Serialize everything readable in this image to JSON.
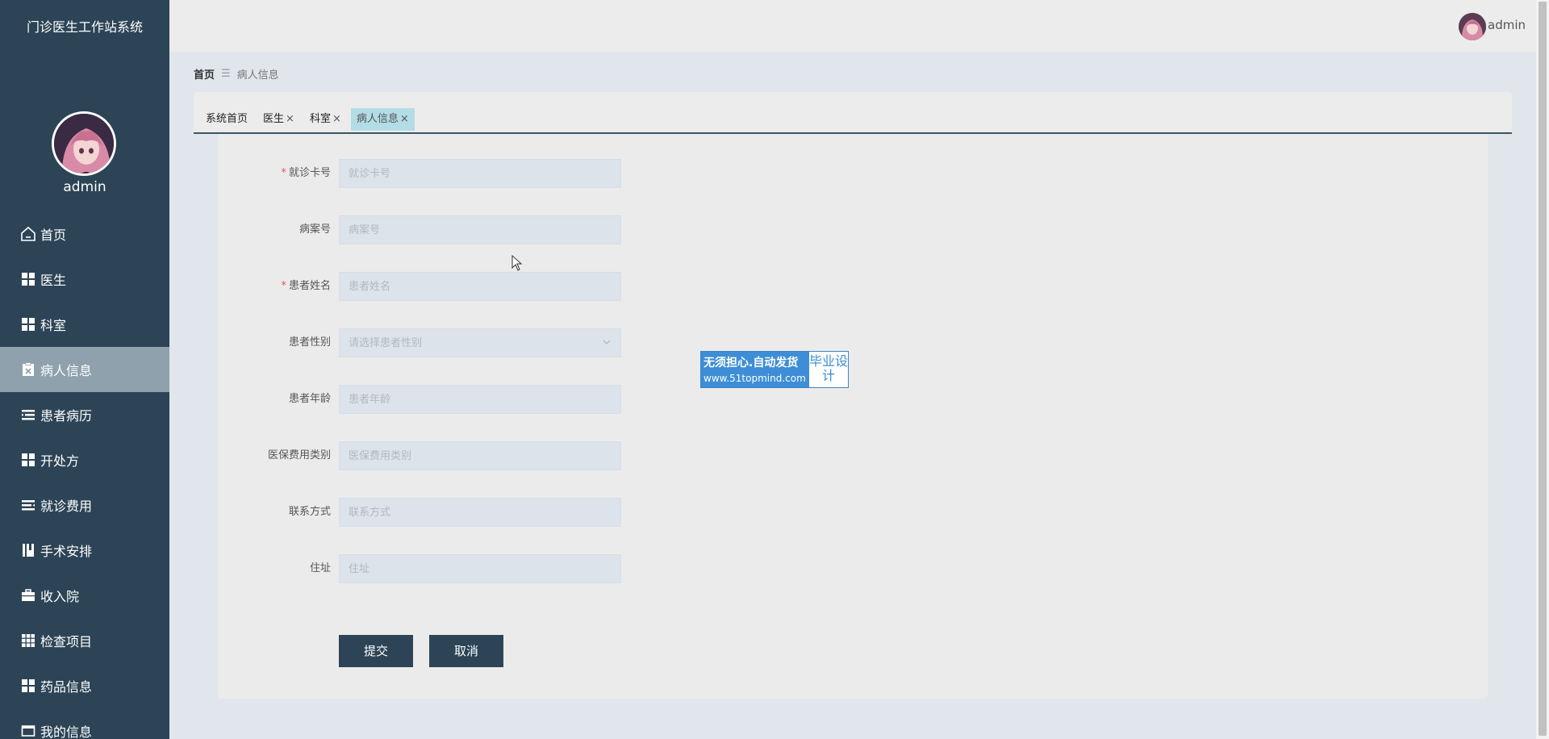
{
  "app": {
    "title": "门诊医生工作站系统",
    "username": "admin"
  },
  "sidebar": {
    "username": "admin",
    "items": [
      {
        "label": "首页",
        "icon": "home-icon"
      },
      {
        "label": "医生",
        "icon": "grid-icon"
      },
      {
        "label": "科室",
        "icon": "grid-icon"
      },
      {
        "label": "病人信息",
        "icon": "clipboard-icon",
        "active": true
      },
      {
        "label": "患者病历",
        "icon": "list-icon"
      },
      {
        "label": "开处方",
        "icon": "grid-icon"
      },
      {
        "label": "就诊费用",
        "icon": "list-icon"
      },
      {
        "label": "手术安排",
        "icon": "book-icon"
      },
      {
        "label": "收入院",
        "icon": "briefcase-icon"
      },
      {
        "label": "检查项目",
        "icon": "grid9-icon"
      },
      {
        "label": "药品信息",
        "icon": "grid-icon"
      },
      {
        "label": "我的信息",
        "icon": "card-icon"
      }
    ]
  },
  "breadcrumb": {
    "home": "首页",
    "separator": "☰",
    "current": "病人信息"
  },
  "tabs": [
    {
      "label": "系统首页",
      "closable": false
    },
    {
      "label": "医生",
      "closable": true
    },
    {
      "label": "科室",
      "closable": true
    },
    {
      "label": "病人信息",
      "closable": true,
      "active": true
    }
  ],
  "form": {
    "fields": [
      {
        "label": "就诊卡号",
        "placeholder": "就诊卡号",
        "required": true
      },
      {
        "label": "病案号",
        "placeholder": "病案号",
        "required": false
      },
      {
        "label": "患者姓名",
        "placeholder": "患者姓名",
        "required": true
      },
      {
        "label": "患者性别",
        "placeholder": "请选择患者性别",
        "required": false,
        "type": "select"
      },
      {
        "label": "患者年龄",
        "placeholder": "患者年龄",
        "required": false
      },
      {
        "label": "医保费用类别",
        "placeholder": "医保费用类别",
        "required": false
      },
      {
        "label": "联系方式",
        "placeholder": "联系方式",
        "required": false
      },
      {
        "label": "住址",
        "placeholder": "住址",
        "required": false
      }
    ],
    "submit_label": "提交",
    "cancel_label": "取消",
    "required_mark": "*"
  },
  "watermark": {
    "line1": "无须担心.自动发货",
    "line2": "www.51topmind.com",
    "right": "毕业设计"
  },
  "colors": {
    "sidebar_bg": "#2c4456",
    "active_menu": "#8ea1ad",
    "active_tab": "#b3dde6",
    "button_bg": "#2c4456",
    "watermark_blue": "#3d8ed6"
  }
}
